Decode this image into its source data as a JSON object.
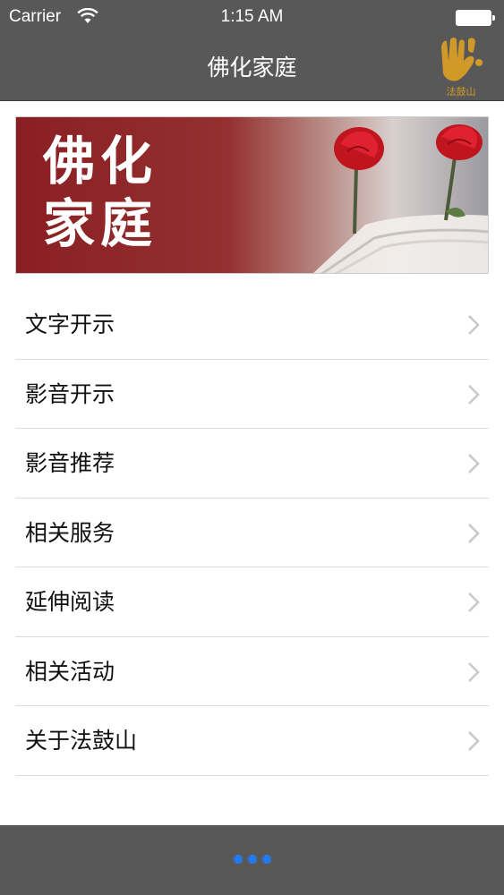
{
  "status_bar": {
    "carrier": "Carrier",
    "time": "1:15 AM"
  },
  "nav": {
    "title": "佛化家庭",
    "logo_text": "法鼓山",
    "logo_icon": "dharma-drum-hand-logo",
    "logo_color": "#d19a28"
  },
  "banner": {
    "text_line1": "佛化",
    "text_line2": "家庭",
    "image": "red-roses-on-book"
  },
  "menu": {
    "items": [
      {
        "label": "文字开示"
      },
      {
        "label": "影音开示"
      },
      {
        "label": "影音推荐"
      },
      {
        "label": "相关服务"
      },
      {
        "label": "延伸阅读"
      },
      {
        "label": "相关活动"
      },
      {
        "label": "关于法鼓山"
      }
    ]
  },
  "colors": {
    "bar_background": "#585858",
    "page_indicator": "#1e7cf0",
    "banner_red": "#8a1f23"
  }
}
